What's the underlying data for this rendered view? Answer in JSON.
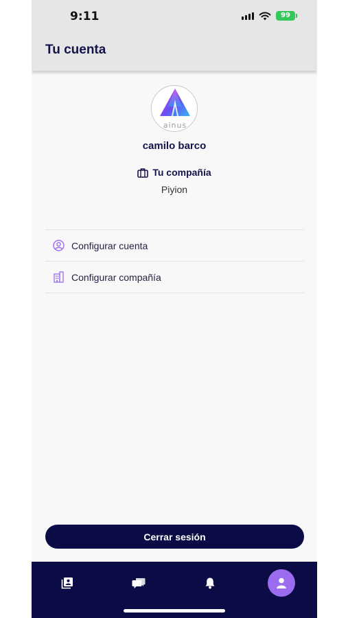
{
  "status_bar": {
    "time": "9:11",
    "battery": "99"
  },
  "header": {
    "title": "Tu cuenta"
  },
  "profile": {
    "logo_text": "ainus",
    "user_name": "camilo barco",
    "company_label": "Tu compañía",
    "company_name": "Piyion"
  },
  "menu": {
    "items": [
      {
        "label": "Configurar cuenta",
        "icon": "user-circle-icon"
      },
      {
        "label": "Configurar compañía",
        "icon": "building-icon"
      }
    ]
  },
  "logout_label": "Cerrar sesión",
  "tabbar": {
    "tabs": [
      {
        "icon": "contacts-icon",
        "active": false
      },
      {
        "icon": "chat-icon",
        "active": false
      },
      {
        "icon": "bell-icon",
        "active": false
      },
      {
        "icon": "user-icon",
        "active": true
      }
    ]
  },
  "colors": {
    "primary_dark": "#0b0b45",
    "accent": "#9b6cf0",
    "battery": "#34c759"
  }
}
